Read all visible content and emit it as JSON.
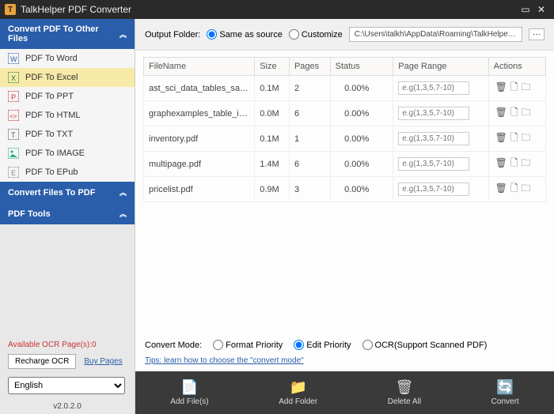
{
  "window": {
    "title": "TalkHelper PDF Converter"
  },
  "sidebar": {
    "panels": [
      {
        "label": "Convert PDF To Other Files"
      },
      {
        "label": "Convert Files To PDF"
      },
      {
        "label": "PDF Tools"
      }
    ],
    "items": [
      {
        "label": "PDF To Word"
      },
      {
        "label": "PDF To Excel"
      },
      {
        "label": "PDF To PPT"
      },
      {
        "label": "PDF To HTML"
      },
      {
        "label": "PDF To TXT"
      },
      {
        "label": "PDF To IMAGE"
      },
      {
        "label": "PDF To EPub"
      }
    ],
    "ocr_label": "Available OCR Page(s):0",
    "recharge_label": "Recharge OCR",
    "buy_label": "Buy Pages",
    "language": "English",
    "version": "v2.0.2.0"
  },
  "output": {
    "label": "Output Folder:",
    "same_label": "Same as source",
    "custom_label": "Customize",
    "path": "C:\\Users\\talkh\\AppData\\Roaming\\TalkHelper PDF",
    "browse": "···"
  },
  "table": {
    "headers": {
      "filename": "FileName",
      "size": "Size",
      "pages": "Pages",
      "status": "Status",
      "pagerange": "Page Range",
      "actions": "Actions"
    },
    "pr_placeholder": "e.g(1,3,5,7-10)",
    "rows": [
      {
        "filename": "ast_sci_data_tables_sample...",
        "size": "0.1M",
        "pages": "2",
        "status": "0.00%"
      },
      {
        "filename": "graphexamples_table_image...",
        "size": "0.0M",
        "pages": "6",
        "status": "0.00%"
      },
      {
        "filename": "inventory.pdf",
        "size": "0.1M",
        "pages": "1",
        "status": "0.00%"
      },
      {
        "filename": "multipage.pdf",
        "size": "1.4M",
        "pages": "6",
        "status": "0.00%"
      },
      {
        "filename": "pricelist.pdf",
        "size": "0.9M",
        "pages": "3",
        "status": "0.00%"
      }
    ]
  },
  "convertmode": {
    "label": "Convert Mode:",
    "format": "Format Priority",
    "edit": "Edit Priority",
    "ocr": "OCR(Support Scanned PDF)"
  },
  "tips": {
    "text": "Tips: learn how to choose the \"convert mode\""
  },
  "bottom": {
    "addfiles": "Add File(s)",
    "addfolder": "Add Folder",
    "deleteall": "Delete All",
    "convert": "Convert"
  },
  "icons": {
    "word": "#2a5daa",
    "excel": "#1e7e34",
    "ppt": "#c9302c",
    "html": "#c9302c",
    "txt": "#555",
    "image": "#2a8",
    "epub": "#888"
  }
}
